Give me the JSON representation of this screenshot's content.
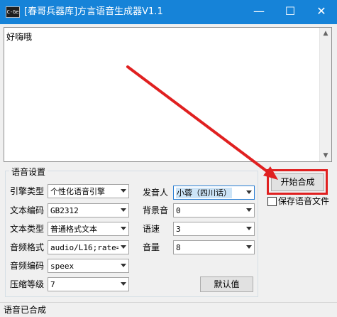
{
  "window": {
    "icon_text": "C-Ge",
    "title": "[春哥兵器库]方言语音生成器V1.1",
    "minimize_glyph": "—",
    "maximize_glyph": "☐",
    "close_glyph": "✕"
  },
  "editor": {
    "text": "好嗨哦"
  },
  "settings": {
    "group_label": "语音设置",
    "engine_type": {
      "label": "引擎类型",
      "value": "个性化语音引擎"
    },
    "text_encoding": {
      "label": "文本编码",
      "value": "GB2312"
    },
    "text_type": {
      "label": "文本类型",
      "value": "普通格式文本"
    },
    "audio_format": {
      "label": "音频格式",
      "value": "audio/L16;rate="
    },
    "audio_encoding": {
      "label": "音频编码",
      "value": "speex"
    },
    "compression_level": {
      "label": "压缩等级",
      "value": "7"
    },
    "speaker": {
      "label": "发音人",
      "value": "小蓉（四川话）"
    },
    "background_sound": {
      "label": "背景音",
      "value": "0"
    },
    "speed": {
      "label": "语速",
      "value": "3"
    },
    "volume": {
      "label": "音量",
      "value": "8"
    },
    "default_button": "默认值"
  },
  "actions": {
    "start_button": "开始合成",
    "save_checkbox_label": "保存语音文件",
    "save_checked": false
  },
  "status": {
    "text": "语音已合成"
  },
  "colors": {
    "titlebar": "#1683d8",
    "annotation": "#e02020"
  }
}
